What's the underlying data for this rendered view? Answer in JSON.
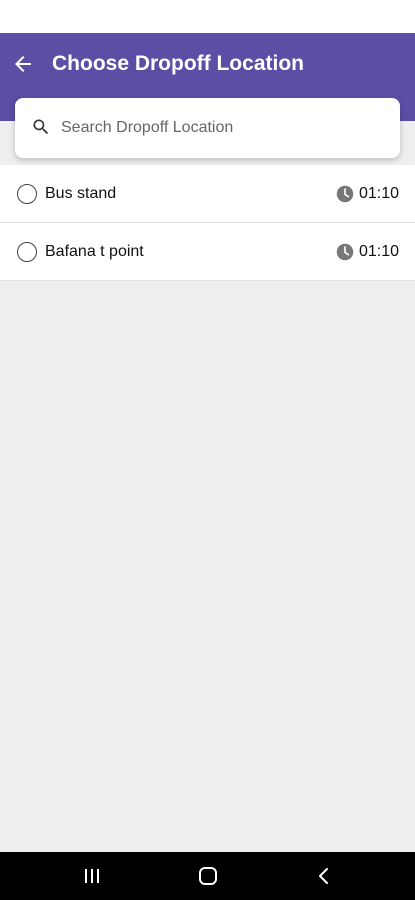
{
  "header": {
    "title": "Choose Dropoff Location",
    "back_icon": "arrow-left-icon",
    "background_color": "#5a4ea5"
  },
  "search": {
    "placeholder": "Search Dropoff Location",
    "value": "",
    "icon": "search-icon"
  },
  "locations": [
    {
      "name": "Bus stand",
      "time": "01:10",
      "selected": false
    },
    {
      "name": "Bafana t point",
      "time": "01:10",
      "selected": false
    }
  ],
  "nav_bar": {
    "buttons": [
      "recents-icon",
      "home-icon",
      "back-icon"
    ]
  }
}
